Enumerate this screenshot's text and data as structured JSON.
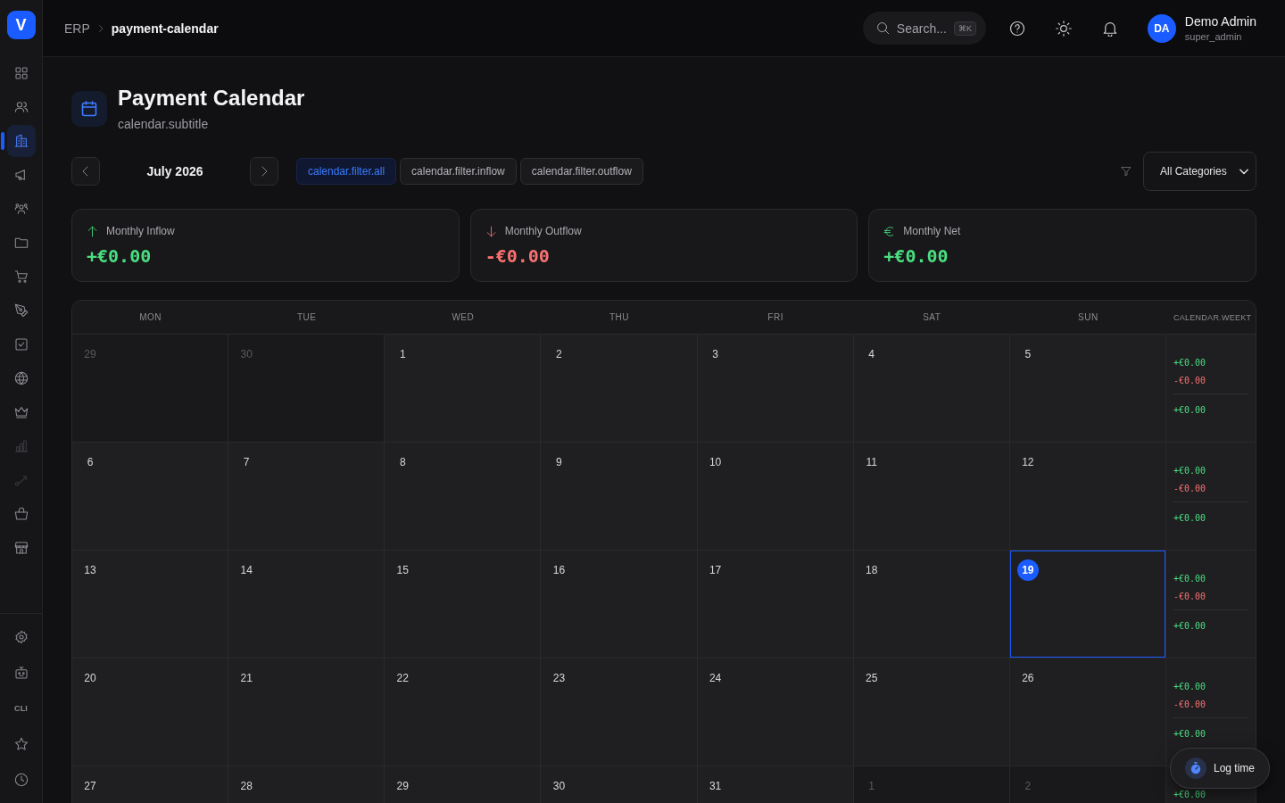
{
  "sidebar": {
    "logo": "V",
    "nav_items": [
      {
        "selected": false,
        "disabled": false
      },
      {
        "selected": false,
        "disabled": false
      },
      {
        "selected": true,
        "disabled": false
      },
      {
        "selected": false,
        "disabled": false
      },
      {
        "selected": false,
        "disabled": false
      },
      {
        "selected": false,
        "disabled": false
      },
      {
        "selected": false,
        "disabled": false
      },
      {
        "selected": false,
        "disabled": false
      },
      {
        "selected": false,
        "disabled": false
      },
      {
        "selected": false,
        "disabled": false
      },
      {
        "selected": false,
        "disabled": false
      },
      {
        "selected": false,
        "disabled": true
      },
      {
        "selected": false,
        "disabled": true
      },
      {
        "selected": false,
        "disabled": false
      },
      {
        "selected": false,
        "disabled": false
      }
    ],
    "bottom_items": [
      {
        "kind": "icon"
      },
      {
        "kind": "icon"
      },
      {
        "kind": "text",
        "label": "CLI"
      },
      {
        "kind": "icon"
      },
      {
        "kind": "icon"
      }
    ]
  },
  "topbar": {
    "breadcrumb": [
      {
        "label": "ERP",
        "current": false
      },
      {
        "label": "payment-calendar",
        "current": true
      }
    ],
    "search": {
      "label": "Search...",
      "shortcut": "⌘K"
    },
    "user": {
      "initials": "DA",
      "name": "Demo Admin",
      "role": "super_admin"
    }
  },
  "page": {
    "title": "Payment Calendar",
    "subtitle": "calendar.subtitle"
  },
  "toolbar": {
    "month": "July 2026",
    "filters": [
      {
        "label": "calendar.filter.all",
        "selected": true
      },
      {
        "label": "calendar.filter.inflow",
        "selected": false
      },
      {
        "label": "calendar.filter.outflow",
        "selected": false
      }
    ],
    "category_select": {
      "value": "All Categories"
    }
  },
  "stats": [
    {
      "kind": "inflow",
      "label": "Monthly Inflow",
      "value": "+€0.00"
    },
    {
      "kind": "outflow",
      "label": "Monthly Outflow",
      "value": "-€0.00"
    },
    {
      "kind": "net",
      "label": "Monthly Net",
      "value": "+€0.00"
    }
  ],
  "calendar": {
    "weekdays": [
      "MON",
      "TUE",
      "WED",
      "THU",
      "FRI",
      "SAT",
      "SUN"
    ],
    "week_column_header": "CALENDAR.WEEKT",
    "weeks": [
      {
        "days": [
          {
            "number": "29",
            "current_month": false,
            "today": false
          },
          {
            "number": "30",
            "current_month": false,
            "today": false
          },
          {
            "number": "1",
            "current_month": true,
            "today": false
          },
          {
            "number": "2",
            "current_month": true,
            "today": false
          },
          {
            "number": "3",
            "current_month": true,
            "today": false
          },
          {
            "number": "4",
            "current_month": true,
            "today": false
          },
          {
            "number": "5",
            "current_month": true,
            "today": false
          }
        ],
        "totals": [
          {
            "kind": "inflow",
            "value": "+€0.00"
          },
          {
            "kind": "outflow",
            "value": "-€0.00"
          },
          {
            "kind": "net",
            "value": "+€0.00"
          }
        ]
      },
      {
        "days": [
          {
            "number": "6",
            "current_month": true,
            "today": false
          },
          {
            "number": "7",
            "current_month": true,
            "today": false
          },
          {
            "number": "8",
            "current_month": true,
            "today": false
          },
          {
            "number": "9",
            "current_month": true,
            "today": false
          },
          {
            "number": "10",
            "current_month": true,
            "today": false
          },
          {
            "number": "11",
            "current_month": true,
            "today": false
          },
          {
            "number": "12",
            "current_month": true,
            "today": false
          }
        ],
        "totals": [
          {
            "kind": "inflow",
            "value": "+€0.00"
          },
          {
            "kind": "outflow",
            "value": "-€0.00"
          },
          {
            "kind": "net",
            "value": "+€0.00"
          }
        ]
      },
      {
        "days": [
          {
            "number": "13",
            "current_month": true,
            "today": false
          },
          {
            "number": "14",
            "current_month": true,
            "today": false
          },
          {
            "number": "15",
            "current_month": true,
            "today": false
          },
          {
            "number": "16",
            "current_month": true,
            "today": false
          },
          {
            "number": "17",
            "current_month": true,
            "today": false
          },
          {
            "number": "18",
            "current_month": true,
            "today": false
          },
          {
            "number": "19",
            "current_month": true,
            "today": true
          }
        ],
        "totals": [
          {
            "kind": "inflow",
            "value": "+€0.00"
          },
          {
            "kind": "outflow",
            "value": "-€0.00"
          },
          {
            "kind": "net",
            "value": "+€0.00"
          }
        ]
      },
      {
        "days": [
          {
            "number": "20",
            "current_month": true,
            "today": false
          },
          {
            "number": "21",
            "current_month": true,
            "today": false
          },
          {
            "number": "22",
            "current_month": true,
            "today": false
          },
          {
            "number": "23",
            "current_month": true,
            "today": false
          },
          {
            "number": "24",
            "current_month": true,
            "today": false
          },
          {
            "number": "25",
            "current_month": true,
            "today": false
          },
          {
            "number": "26",
            "current_month": true,
            "today": false
          }
        ],
        "totals": [
          {
            "kind": "inflow",
            "value": "+€0.00"
          },
          {
            "kind": "outflow",
            "value": "-€0.00"
          },
          {
            "kind": "net",
            "value": "+€0.00"
          }
        ]
      },
      {
        "days": [
          {
            "number": "27",
            "current_month": true,
            "today": false
          },
          {
            "number": "28",
            "current_month": true,
            "today": false
          },
          {
            "number": "29",
            "current_month": true,
            "today": false
          },
          {
            "number": "30",
            "current_month": true,
            "today": false
          },
          {
            "number": "31",
            "current_month": true,
            "today": false
          },
          {
            "number": "1",
            "current_month": false,
            "today": false
          },
          {
            "number": "2",
            "current_month": false,
            "today": false
          }
        ],
        "totals": [
          {
            "kind": "inflow",
            "value": "+€0.00"
          }
        ]
      }
    ]
  },
  "log_time_button": {
    "label": "Log time"
  }
}
